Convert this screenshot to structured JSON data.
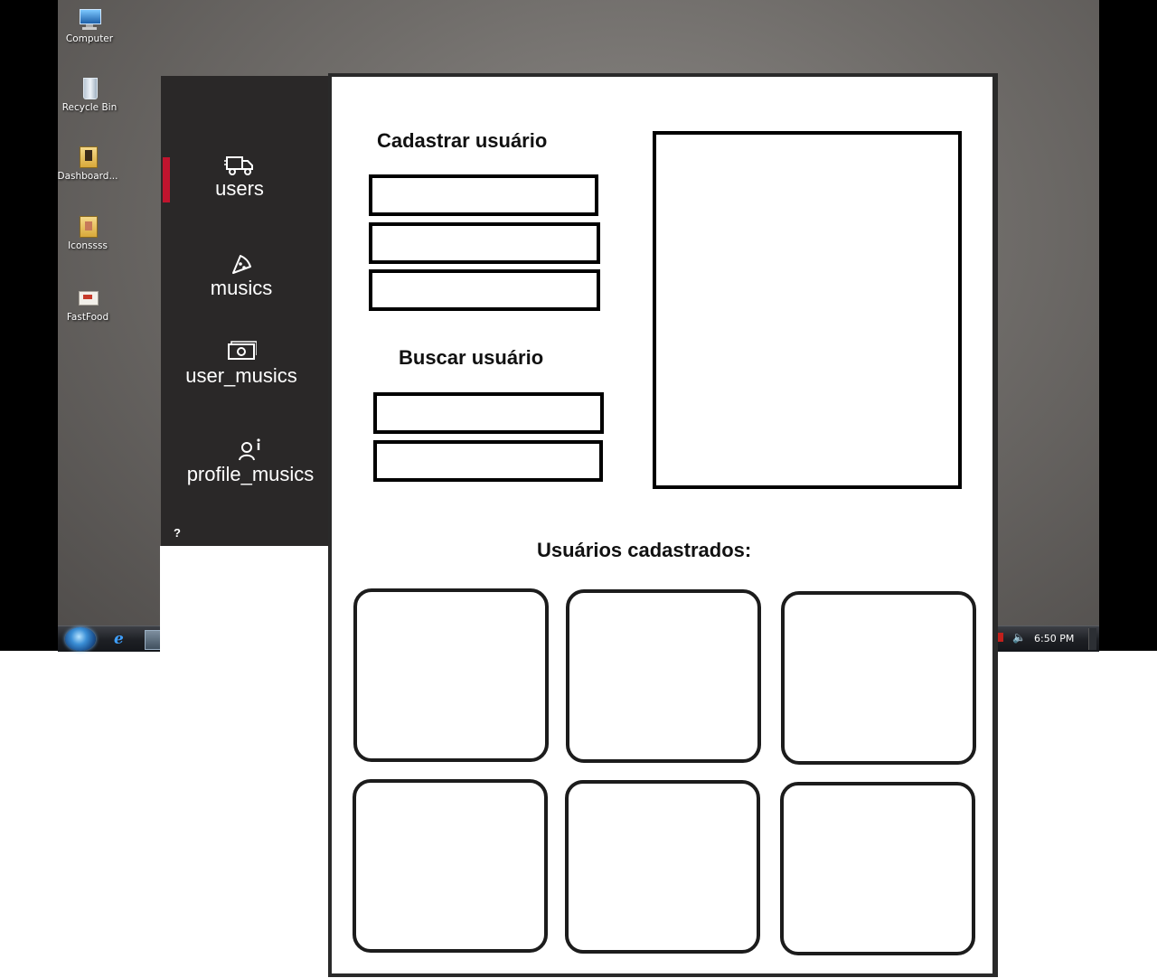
{
  "desktop": {
    "icons": [
      {
        "label": "Computer",
        "icon": "computer-icon"
      },
      {
        "label": "Recycle Bin",
        "icon": "recycle-bin-icon"
      },
      {
        "label": "Dashboard...",
        "icon": "folder-icon"
      },
      {
        "label": "Iconssss",
        "icon": "folder-icon"
      },
      {
        "label": "FastFood",
        "icon": "shortcut-icon"
      }
    ],
    "taskbar": {
      "clock": "6:50 PM"
    }
  },
  "sidebar": {
    "items": [
      {
        "label": "users",
        "icon": "truck-icon",
        "active": true
      },
      {
        "label": "musics",
        "icon": "pizza-slice-icon",
        "active": false
      },
      {
        "label": "user_musics",
        "icon": "money-icon",
        "active": false
      },
      {
        "label": "profile_musics",
        "icon": "user-info-icon",
        "active": false
      }
    ],
    "help": "?",
    "accent_color": "#c0142e",
    "background_color": "#2a2828"
  },
  "main": {
    "register_title": "Cadastrar usuário",
    "register_fields": [
      "",
      "",
      ""
    ],
    "search_title": "Buscar usuário",
    "search_fields": [
      "",
      ""
    ],
    "list_title": "Usuários cadastrados:",
    "card_count": 6
  }
}
